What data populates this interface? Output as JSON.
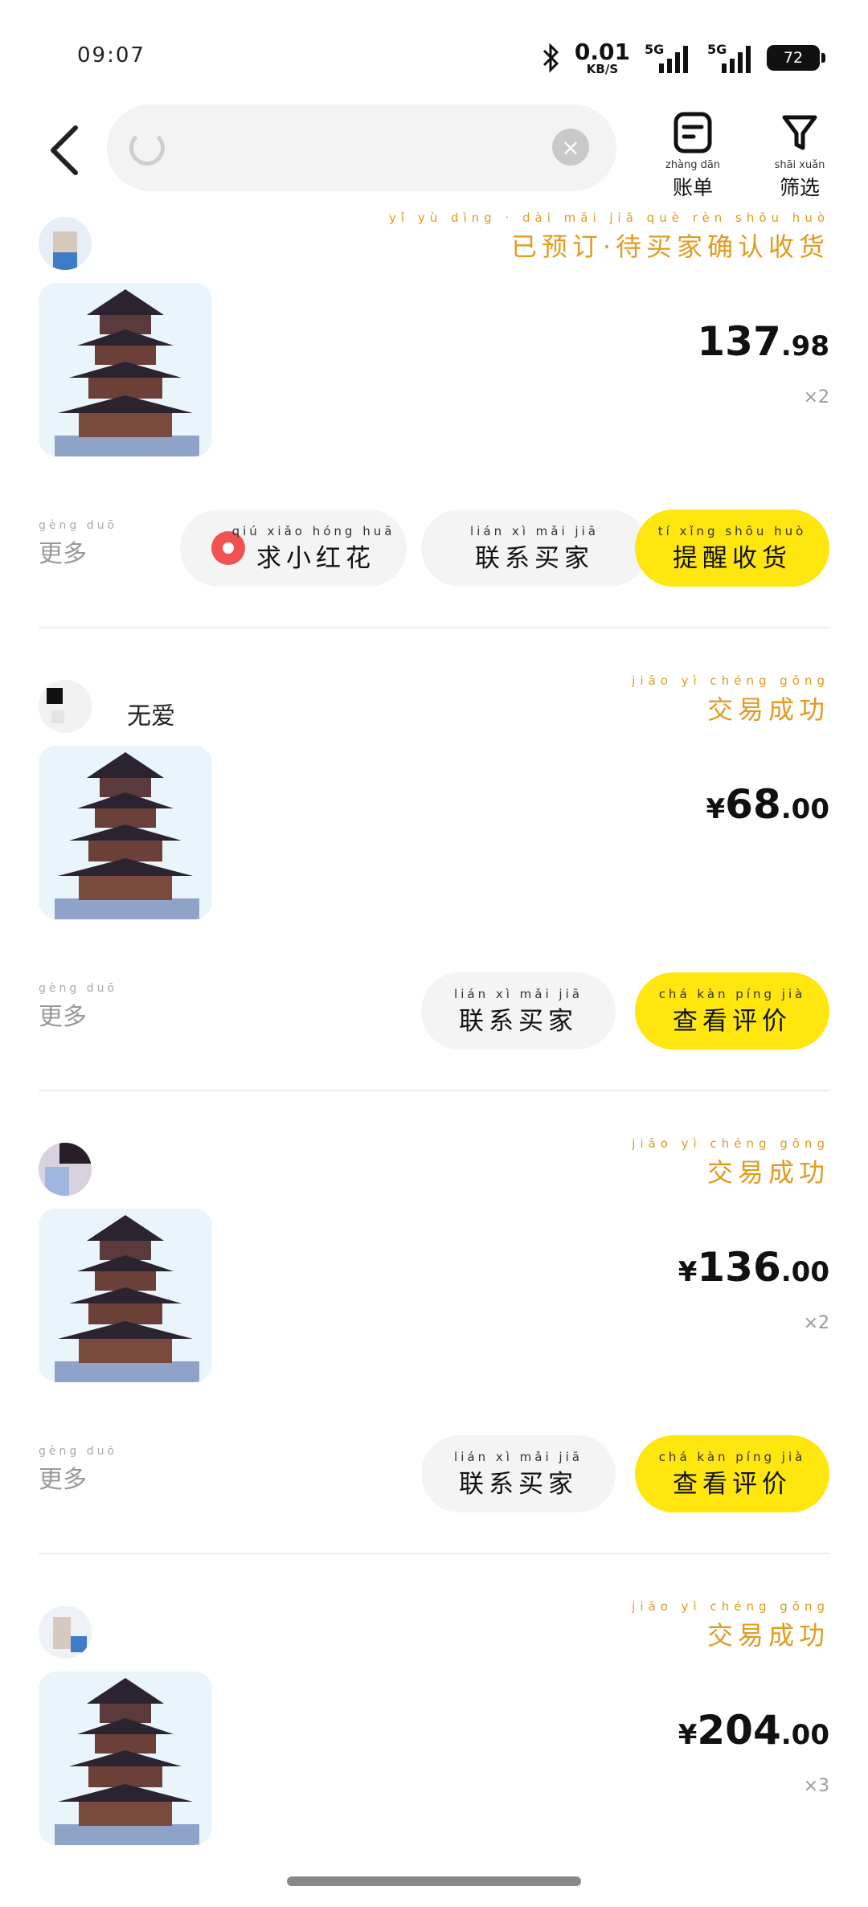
{
  "status_bar": {
    "time": "09:07",
    "net_speed_value": "0.01",
    "net_speed_unit": "KB/S",
    "battery": "72",
    "icons": [
      "bluetooth-icon",
      "signal-5g-icon",
      "signal-5g-icon",
      "battery-icon"
    ]
  },
  "top_bar": {
    "search_text": "",
    "bill": {
      "pinyin": "zhàng dān",
      "label": "账单"
    },
    "filter": {
      "pinyin": "shāi xuǎn",
      "label": "筛选"
    }
  },
  "orders": [
    {
      "seller": "",
      "status_pinyin": "yǐ yù dìng · dài mǎi jiā què rèn shōu huò",
      "status": "已预订·待买家确认收货",
      "title": "",
      "price_int": "137",
      "price_dec": ".98",
      "qty": "×2",
      "more": {
        "pinyin": "gèng duō",
        "label": "更多"
      },
      "buttons": [
        {
          "pinyin": "qiú xiǎo hóng huā",
          "label": "求小红花",
          "style": "gray",
          "icon": "red-flower-icon"
        },
        {
          "pinyin": "lián xì mǎi jiā",
          "label": "联系买家",
          "style": "gray"
        },
        {
          "pinyin": "tí xǐng shōu huò",
          "label": "提醒收货",
          "style": "yellow"
        }
      ]
    },
    {
      "seller": "无爱",
      "status_pinyin": "jiāo yì chéng gōng",
      "status": "交易成功",
      "title": "",
      "price_yen": "¥",
      "price_int": "68",
      "price_dec": ".00",
      "more": {
        "pinyin": "gèng duō",
        "label": "更多"
      },
      "buttons": [
        {
          "pinyin": "lián xì mǎi jiā",
          "label": "联系买家",
          "style": "gray"
        },
        {
          "pinyin": "chá kàn píng jià",
          "label": "查看评价",
          "style": "yellow"
        }
      ]
    },
    {
      "seller": "",
      "status_pinyin": "jiāo yì chéng gōng",
      "status": "交易成功",
      "title": "",
      "price_yen": "¥",
      "price_int": "136",
      "price_dec": ".00",
      "qty": "×2",
      "more": {
        "pinyin": "gèng duō",
        "label": "更多"
      },
      "buttons": [
        {
          "pinyin": "lián xì mǎi jiā",
          "label": "联系买家",
          "style": "gray"
        },
        {
          "pinyin": "chá kàn píng jià",
          "label": "查看评价",
          "style": "yellow"
        }
      ]
    },
    {
      "seller": "",
      "status_pinyin": "jiāo yì chéng gōng",
      "status": "交易成功",
      "title": "",
      "price_yen": "¥",
      "price_int": "204",
      "price_dec": ".00",
      "qty": "×3"
    }
  ],
  "colors": {
    "accent_yellow": "#ffe60f",
    "status_orange": "#e39a1f"
  }
}
